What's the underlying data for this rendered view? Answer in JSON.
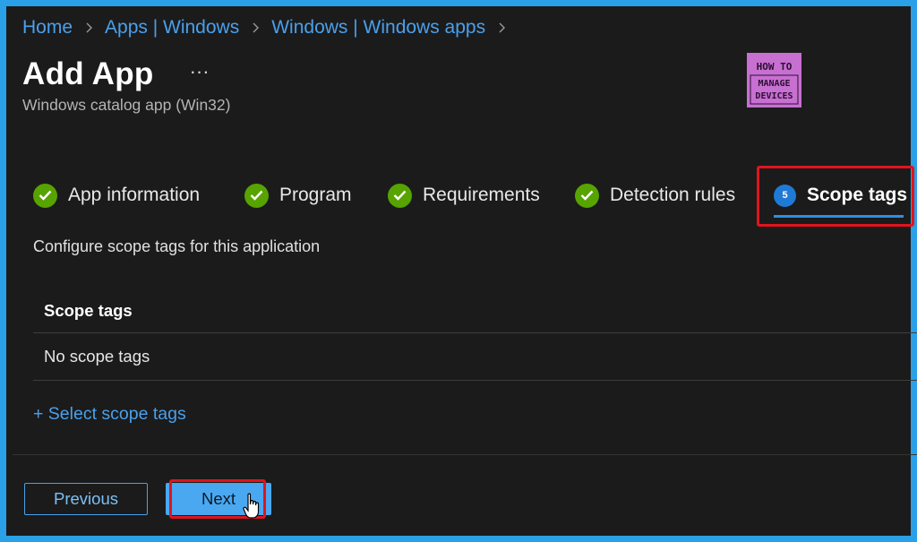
{
  "breadcrumb": [
    "Home",
    "Apps | Windows",
    "Windows | Windows apps"
  ],
  "page": {
    "title": "Add App",
    "more_label": "···",
    "subtitle": "Windows catalog app (Win32)"
  },
  "logo": {
    "line1": "HOW TO",
    "line2": "MANAGE",
    "line3": "DEVICES"
  },
  "tabs": [
    {
      "label": "App information",
      "state": "complete"
    },
    {
      "label": "Program",
      "state": "complete"
    },
    {
      "label": "Requirements",
      "state": "complete"
    },
    {
      "label": "Detection rules",
      "state": "complete"
    },
    {
      "label": "Scope tags",
      "state": "active",
      "step": "5"
    }
  ],
  "main": {
    "description": "Configure scope tags for this application",
    "table": {
      "header": "Scope tags",
      "rows": [
        "No scope tags"
      ]
    },
    "select_link": "+ Select scope tags"
  },
  "footer": {
    "previous_label": "Previous",
    "next_label": "Next"
  },
  "icons": {
    "chevron": "chevron-right-icon",
    "check": "checkmark-circle-icon",
    "cursor": "hand-pointer-icon"
  },
  "colors": {
    "accent": "#2d8ee6",
    "link": "#4aa0ec",
    "success": "#57a300",
    "highlight": "#e0141e",
    "frame": "#2aa0e8",
    "logo_bg": "#c86fd2"
  }
}
